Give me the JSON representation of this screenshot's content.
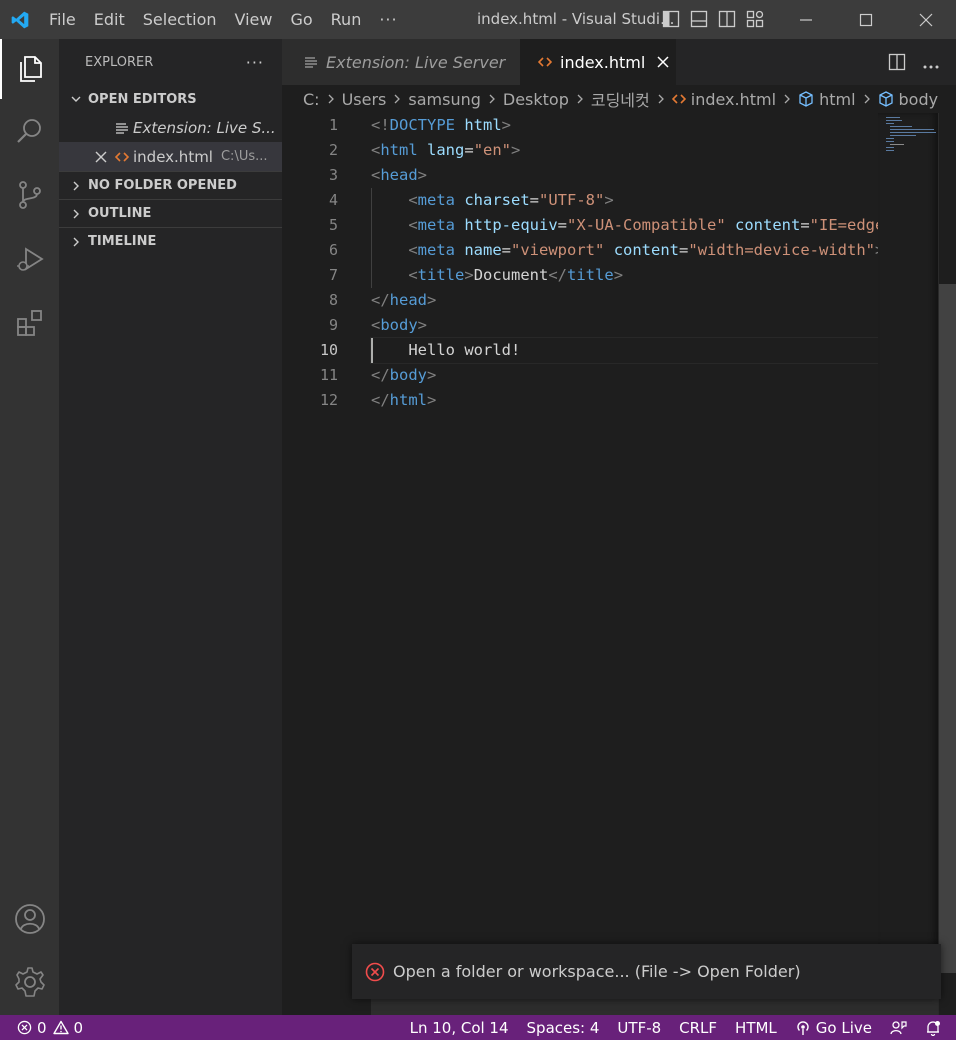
{
  "window": {
    "title": "index.html - Visual Studi...",
    "menu": [
      "File",
      "Edit",
      "Selection",
      "View",
      "Go",
      "Run"
    ],
    "menu_more": "···"
  },
  "sidebar": {
    "title": "EXPLORER",
    "more": "···",
    "sections": {
      "open_editors": "OPEN EDITORS",
      "no_folder": "NO FOLDER OPENED",
      "outline": "OUTLINE",
      "timeline": "TIMELINE"
    },
    "open_editors": [
      {
        "name": "Extension: Live S...",
        "desc": "",
        "italic": true
      },
      {
        "name": "index.html",
        "desc": "C:\\Us...",
        "italic": false
      }
    ]
  },
  "tabs": [
    {
      "label": "Extension: Live Server",
      "active": false
    },
    {
      "label": "index.html",
      "active": true
    }
  ],
  "breadcrumb": [
    "C:",
    "Users",
    "samsung",
    "Desktop",
    "코딩네컷",
    "index.html",
    "html",
    "body"
  ],
  "editor": {
    "line_numbers": [
      "1",
      "2",
      "3",
      "4",
      "5",
      "6",
      "7",
      "8",
      "9",
      "10",
      "11",
      "12"
    ],
    "current_line": 10
  },
  "notification": {
    "message": "Open a folder or workspace... (File -> Open Folder)"
  },
  "statusbar": {
    "errors": "0",
    "warnings": "0",
    "position": "Ln 10, Col 14",
    "spaces": "Spaces: 4",
    "encoding": "UTF-8",
    "eol": "CRLF",
    "language": "HTML",
    "go_live": "Go Live"
  },
  "colors": {
    "statusbar": "#68217a",
    "activity_bar": "#333333",
    "sidebar": "#252526",
    "editor": "#1e1e1e",
    "accent": "#007acc"
  }
}
